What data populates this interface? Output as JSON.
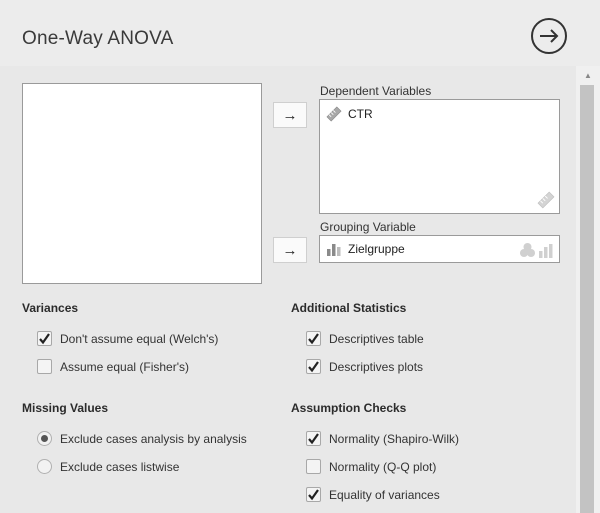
{
  "header": {
    "title": "One-Way ANOVA",
    "run_icon": "arrow-circle-right-icon"
  },
  "dependent": {
    "label": "Dependent Variables",
    "variable": "CTR",
    "variable_icon": "ruler-icon"
  },
  "grouping": {
    "label": "Grouping Variable",
    "variable": "Zielgruppe",
    "variable_icon": "bar-chart-icon"
  },
  "variances": {
    "title": "Variances",
    "options": [
      {
        "label": "Don't assume equal (Welch's)",
        "checked": true
      },
      {
        "label": "Assume equal (Fisher's)",
        "checked": false
      }
    ]
  },
  "additional": {
    "title": "Additional Statistics",
    "options": [
      {
        "label": "Descriptives table",
        "checked": true
      },
      {
        "label": "Descriptives plots",
        "checked": true
      }
    ]
  },
  "missing": {
    "title": "Missing Values",
    "options": [
      {
        "label": "Exclude cases analysis by analysis",
        "selected": true
      },
      {
        "label": "Exclude cases listwise",
        "selected": false
      }
    ]
  },
  "assumptions": {
    "title": "Assumption Checks",
    "options": [
      {
        "label": "Normality (Shapiro-Wilk)",
        "checked": true
      },
      {
        "label": "Normality (Q-Q plot)",
        "checked": false
      },
      {
        "label": "Equality of variances",
        "checked": true
      }
    ]
  }
}
